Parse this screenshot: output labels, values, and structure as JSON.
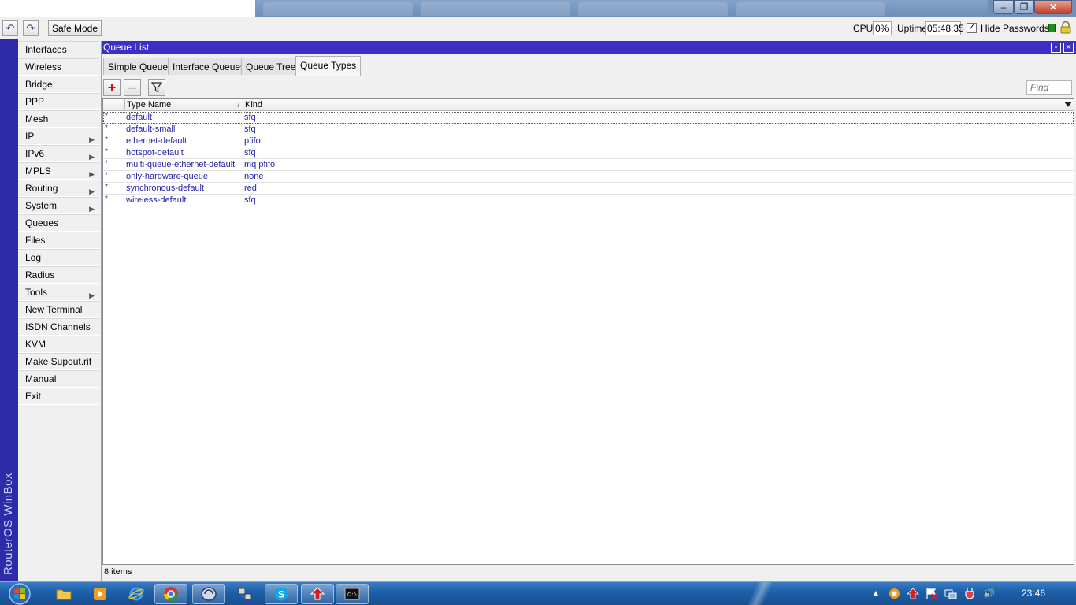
{
  "toolbar": {
    "undo_glyph": "↶",
    "redo_glyph": "↷",
    "safe_mode_label": "Safe Mode",
    "cpu_label": "CPU:",
    "cpu_value": "0%",
    "uptime_label": "Uptime:",
    "uptime_value": "05:48:35",
    "hide_passwords_label": "Hide Passwords",
    "hide_passwords_checked": "✓"
  },
  "brand": {
    "text": "RouterOS WinBox"
  },
  "sidebar": {
    "items": [
      {
        "label": "Interfaces",
        "submenu": ""
      },
      {
        "label": "Wireless",
        "submenu": ""
      },
      {
        "label": "Bridge",
        "submenu": ""
      },
      {
        "label": "PPP",
        "submenu": ""
      },
      {
        "label": "Mesh",
        "submenu": ""
      },
      {
        "label": "IP",
        "submenu": "▶"
      },
      {
        "label": "IPv6",
        "submenu": "▶"
      },
      {
        "label": "MPLS",
        "submenu": "▶"
      },
      {
        "label": "Routing",
        "submenu": "▶"
      },
      {
        "label": "System",
        "submenu": "▶"
      },
      {
        "label": "Queues",
        "submenu": ""
      },
      {
        "label": "Files",
        "submenu": ""
      },
      {
        "label": "Log",
        "submenu": ""
      },
      {
        "label": "Radius",
        "submenu": ""
      },
      {
        "label": "Tools",
        "submenu": "▶"
      },
      {
        "label": "New Terminal",
        "submenu": ""
      },
      {
        "label": "ISDN Channels",
        "submenu": ""
      },
      {
        "label": "KVM",
        "submenu": ""
      },
      {
        "label": "Make Supout.rif",
        "submenu": ""
      },
      {
        "label": "Manual",
        "submenu": ""
      },
      {
        "label": "Exit",
        "submenu": ""
      }
    ]
  },
  "window": {
    "title": "Queue List",
    "restore_glyph": "▫",
    "close_glyph": "✕",
    "tabs": [
      {
        "label": "Simple Queues"
      },
      {
        "label": "Interface Queues"
      },
      {
        "label": "Queue Tree"
      },
      {
        "label": "Queue Types"
      }
    ],
    "actions": {
      "add_glyph": "+",
      "remove_glyph": "—"
    },
    "find_placeholder": "Find",
    "columns": {
      "type_name": "Type Name",
      "kind": "Kind",
      "sort_glyph": "/"
    },
    "rows": [
      {
        "flag": "*",
        "type_name": "default",
        "kind": "sfq"
      },
      {
        "flag": "*",
        "type_name": "default-small",
        "kind": "sfq"
      },
      {
        "flag": "*",
        "type_name": "ethernet-default",
        "kind": "pfifo"
      },
      {
        "flag": "*",
        "type_name": "hotspot-default",
        "kind": "sfq"
      },
      {
        "flag": "*",
        "type_name": "multi-queue-ethernet-default",
        "kind": "mq pfifo"
      },
      {
        "flag": "*",
        "type_name": "only-hardware-queue",
        "kind": "none"
      },
      {
        "flag": "*",
        "type_name": "synchronous-default",
        "kind": "red"
      },
      {
        "flag": "*",
        "type_name": "wireless-default",
        "kind": "sfq"
      }
    ],
    "status": "8 items"
  },
  "taskbar": {
    "clock": "23:46",
    "tray_up_glyph": "▲",
    "volume_glyph": "🔊"
  },
  "colors": {
    "title_blue": "#3a2fc7",
    "brand_strip": "#2d2ba8",
    "row_text": "#1f1fa8"
  }
}
